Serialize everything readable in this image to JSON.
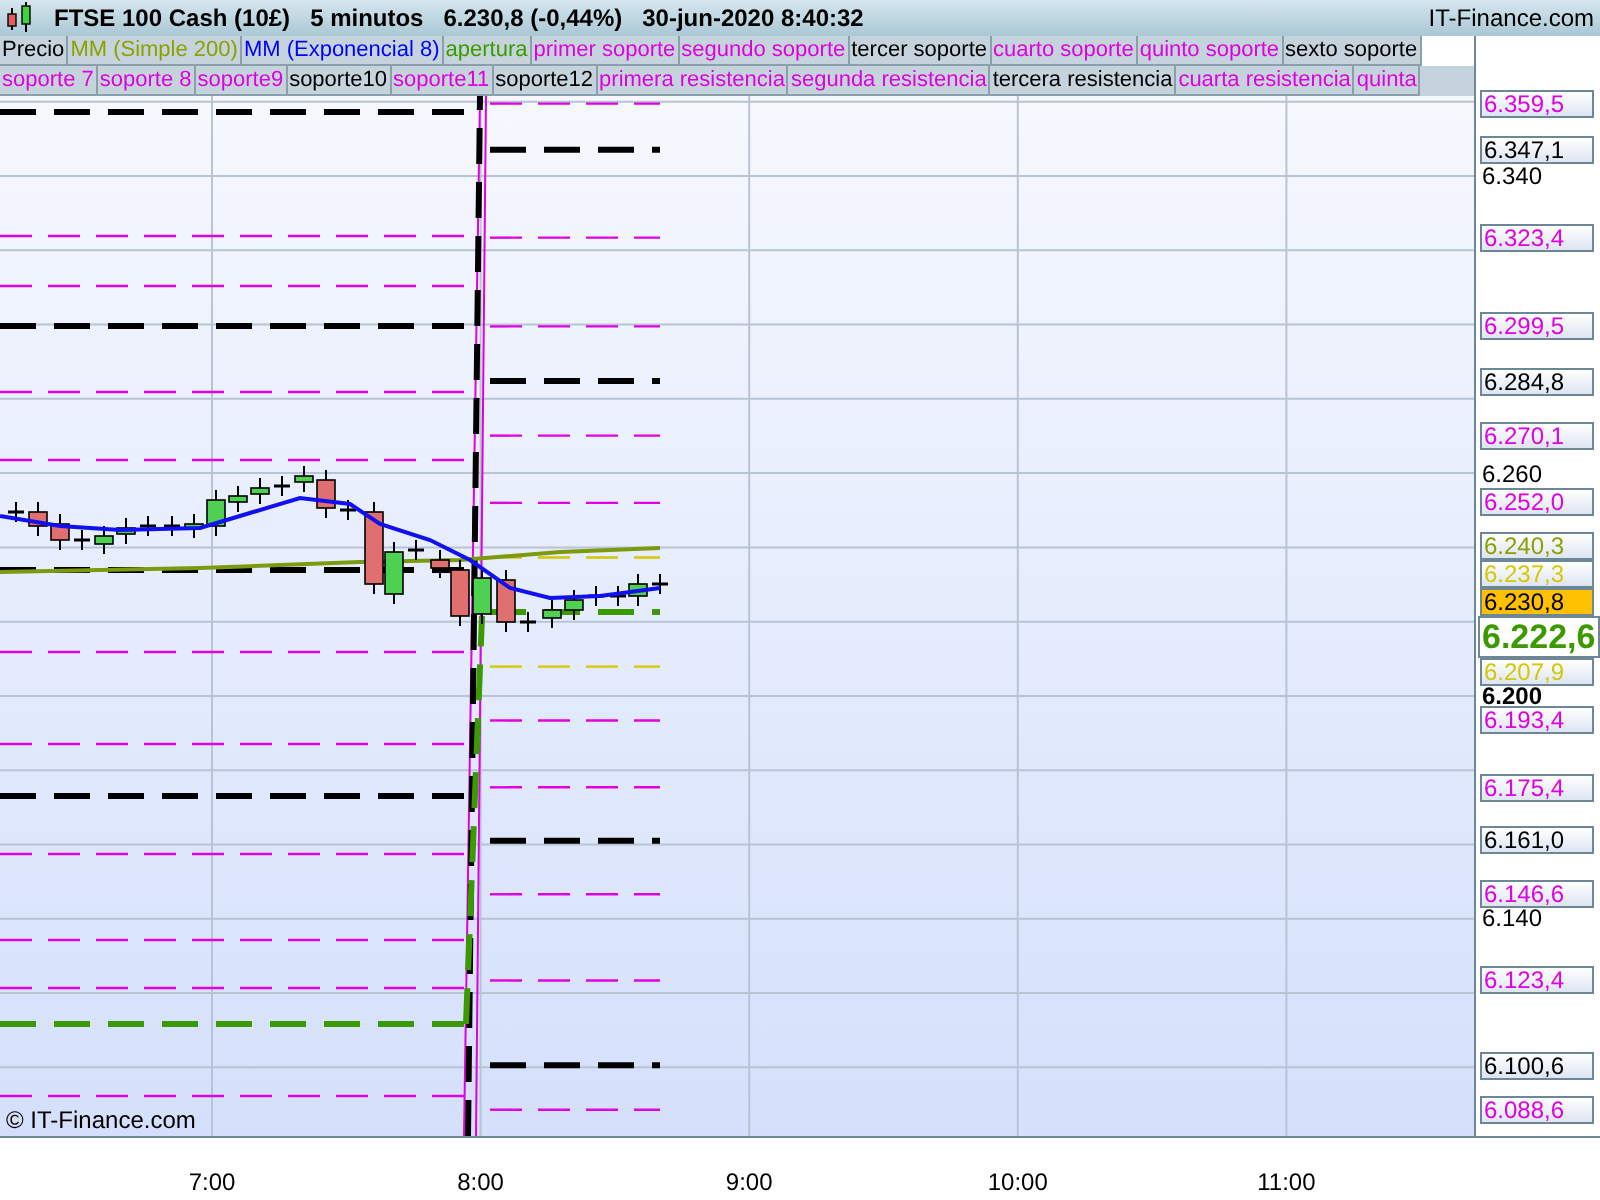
{
  "header": {
    "instrument": "FTSE 100 Cash (10£)",
    "interval": "5 minutos",
    "quote": "6.230,8 (-0,44%)",
    "datetime": "30-jun-2020 8:40:32",
    "brand": "IT-Finance.com"
  },
  "legend_top": [
    {
      "label": "Precio",
      "color": "#000000"
    },
    {
      "label": "MM (Simple 200)",
      "color": "#8ca000"
    },
    {
      "label": "MM (Exponencial 8)",
      "color": "#0000ff"
    },
    {
      "label": "apertura",
      "color": "#3a9a00"
    },
    {
      "label": "primer soporte",
      "color": "#e000e0"
    },
    {
      "label": "segundo soporte",
      "color": "#e000e0"
    },
    {
      "label": "tercer soporte",
      "color": "#000000"
    },
    {
      "label": "cuarto soporte",
      "color": "#e000e0"
    },
    {
      "label": "quinto soporte",
      "color": "#e000e0"
    },
    {
      "label": "sexto soporte",
      "color": "#000000"
    }
  ],
  "legend_bottom": [
    {
      "label": "soporte 7",
      "color": "#e000e0"
    },
    {
      "label": "soporte 8",
      "color": "#e000e0"
    },
    {
      "label": "soporte9",
      "color": "#e000e0"
    },
    {
      "label": "soporte10",
      "color": "#000000"
    },
    {
      "label": "soporte11",
      "color": "#e000e0"
    },
    {
      "label": "soporte12",
      "color": "#000000"
    },
    {
      "label": "primera resistencia",
      "color": "#e000e0"
    },
    {
      "label": "segunda resistencia",
      "color": "#e000e0"
    },
    {
      "label": "tercera resistencia",
      "color": "#000000"
    },
    {
      "label": "cuarta resistencia",
      "color": "#e000e0"
    },
    {
      "label": "quinta",
      "color": "#e000e0"
    }
  ],
  "price_axis": {
    "ticks": [
      {
        "label": "6.340",
        "bold": false
      },
      {
        "label": "6.260",
        "bold": false
      },
      {
        "label": "6.200",
        "bold": true
      },
      {
        "label": "6.140",
        "bold": false
      }
    ],
    "levels": [
      {
        "label": "6.359,5",
        "color": "#e000e0",
        "kind": "level"
      },
      {
        "label": "6.347,1",
        "color": "#000000",
        "kind": "major"
      },
      {
        "label": "6.323,4",
        "color": "#e000e0",
        "kind": "level"
      },
      {
        "label": "6.299,5",
        "color": "#e000e0",
        "kind": "level"
      },
      {
        "label": "6.284,8",
        "color": "#000000",
        "kind": "major"
      },
      {
        "label": "6.270,1",
        "color": "#e000e0",
        "kind": "level"
      },
      {
        "label": "6.252,0",
        "color": "#e000e0",
        "kind": "level"
      },
      {
        "label": "6.240,3",
        "color": "#8ca000",
        "kind": "average"
      },
      {
        "label": "6.237,3",
        "color": "#d4c800",
        "kind": "level"
      },
      {
        "label": "6.230,8",
        "kind": "price"
      },
      {
        "label": "6.222,6",
        "color": "#3a9a00",
        "kind": "last"
      },
      {
        "label": "6.207,9",
        "color": "#d4c800",
        "kind": "level"
      },
      {
        "label": "6.193,4",
        "color": "#e000e0",
        "kind": "level"
      },
      {
        "label": "6.175,4",
        "color": "#e000e0",
        "kind": "level"
      },
      {
        "label": "6.161,0",
        "color": "#000000",
        "kind": "major"
      },
      {
        "label": "6.146,6",
        "color": "#e000e0",
        "kind": "level"
      },
      {
        "label": "6.123,4",
        "color": "#e000e0",
        "kind": "level"
      },
      {
        "label": "6.100,6",
        "color": "#000000",
        "kind": "major"
      },
      {
        "label": "6.088,6",
        "color": "#e000e0",
        "kind": "level"
      }
    ]
  },
  "time_axis": {
    "ticks": [
      "7:00",
      "8:00",
      "9:00",
      "10:00",
      "11:00"
    ]
  },
  "copyright": "© IT-Finance.com"
}
